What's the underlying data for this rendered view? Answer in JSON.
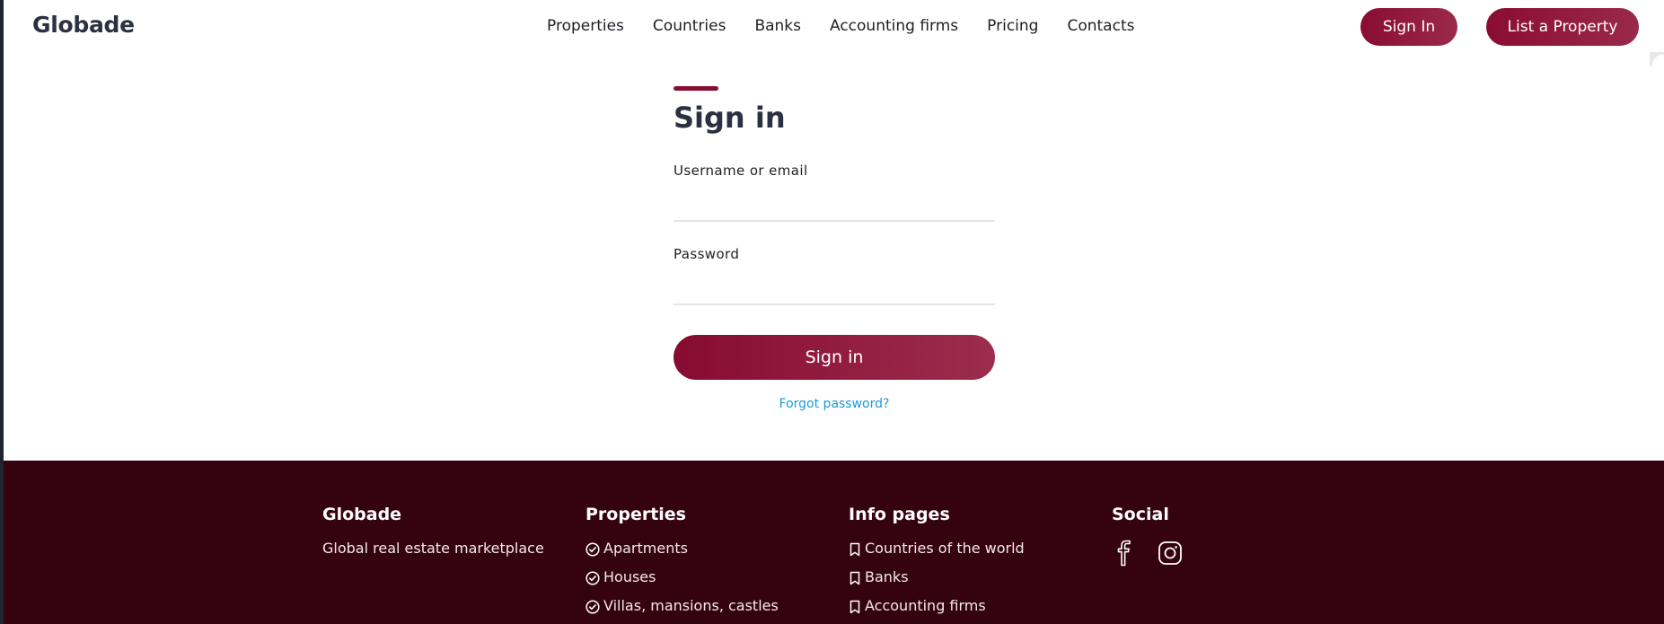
{
  "header": {
    "logo": "Globade",
    "nav": [
      "Properties",
      "Countries",
      "Banks",
      "Accounting firms",
      "Pricing",
      "Contacts"
    ],
    "sign_in_label": "Sign In",
    "list_property_label": "List a Property"
  },
  "signin": {
    "title": "Sign in",
    "username_label": "Username or email",
    "username_value": "",
    "password_label": "Password",
    "password_value": "",
    "submit_label": "Sign in",
    "forgot_label": "Forgot password?"
  },
  "footer": {
    "brand": {
      "title": "Globade",
      "tagline": "Global real estate marketplace"
    },
    "properties": {
      "title": "Properties",
      "items": [
        "Apartments",
        "Houses",
        "Villas, mansions, castles"
      ],
      "icon": "check-circle-icon"
    },
    "info": {
      "title": "Info pages",
      "items": [
        "Countries of the world",
        "Banks",
        "Accounting firms"
      ],
      "icon": "bookmark-icon"
    },
    "social": {
      "title": "Social",
      "icons": [
        "facebook-icon",
        "instagram-icon"
      ]
    }
  },
  "colors": {
    "accent": "#8a0c32",
    "footer_bg": "#350310",
    "link": "#1a9bd7"
  }
}
